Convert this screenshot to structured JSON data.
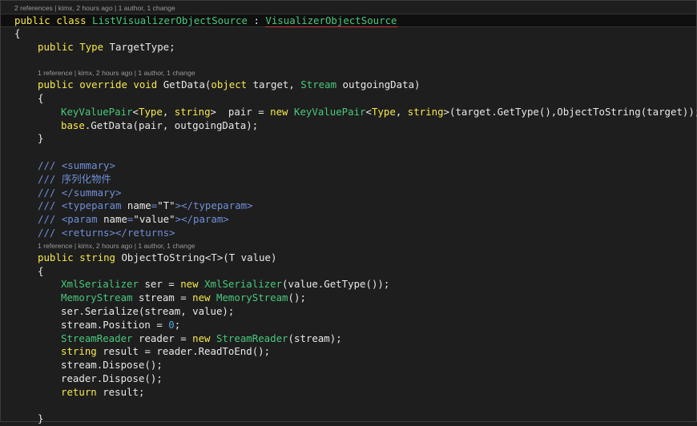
{
  "lens": {
    "class": "2 references | kimx, 2 hours ago | 1 author, 1 change",
    "getdata": "1 reference | kimx, 2 hours ago | 1 author, 1 change",
    "objecttostring": "1 reference | kimx, 2 hours ago | 1 author, 1 change"
  },
  "code": {
    "public": "public",
    "class": "class",
    "override": "override",
    "void": "void",
    "object": "object",
    "string": "string",
    "new": "new",
    "base": "base",
    "return": "return",
    "class_name": "ListVisualizerObjectSource",
    "colon": " : ",
    "base_type": "VisualizerObjectSource",
    "open_brace": "{",
    "close_brace": "}",
    "type_kw": "Type",
    "target_type_field": " TargetType;",
    "get_data": " GetData(",
    "target_param": " target, ",
    "stream_type": "Stream",
    "outgoing_param": " outgoingData)",
    "kvp_type": "KeyValuePair",
    "lt": "<",
    "comma_sp": ", ",
    "gt_sp": "> ",
    "pair_assign": " pair = ",
    "sp": " ",
    "gt_paren": ">(target.GetType(),ObjectToString(target));",
    "base_call": ".GetData(pair, outgoingData);",
    "doc_summary_open": "/// <summary>",
    "doc_prefix": "/// ",
    "doc_text": "序列化物件",
    "doc_summary_close": "/// </summary>",
    "typeparam_open": "<typeparam ",
    "name_attr": "name",
    "eq": "=",
    "quote": "\"",
    "t_value": "T",
    "typeparam_close": "></typeparam>",
    "param_open": "<param ",
    "value_value": "value",
    "param_close": "></param>",
    "returns": "/// <returns></returns>",
    "method_name": " ObjectToString<T>(T value)",
    "xml_serializer": "XmlSerializer",
    "ser_assign": " ser = ",
    "xml_ctor_args": "(value.GetType());",
    "memory_stream": "MemoryStream",
    "stream_assign": " stream = ",
    "empty_ctor": "();",
    "serialize_call": "ser.Serialize(stream, value);",
    "position_assign": "stream.Position = ",
    "zero": "0",
    "semicolon": ";",
    "stream_reader": "StreamReader",
    "reader_assign": " reader = ",
    "reader_ctor_args": "(stream);",
    "result_assign": " result = reader.ReadToEnd();",
    "stream_dispose": "stream.Dispose();",
    "reader_dispose": "reader.Dispose();",
    "result_return": " result;"
  }
}
